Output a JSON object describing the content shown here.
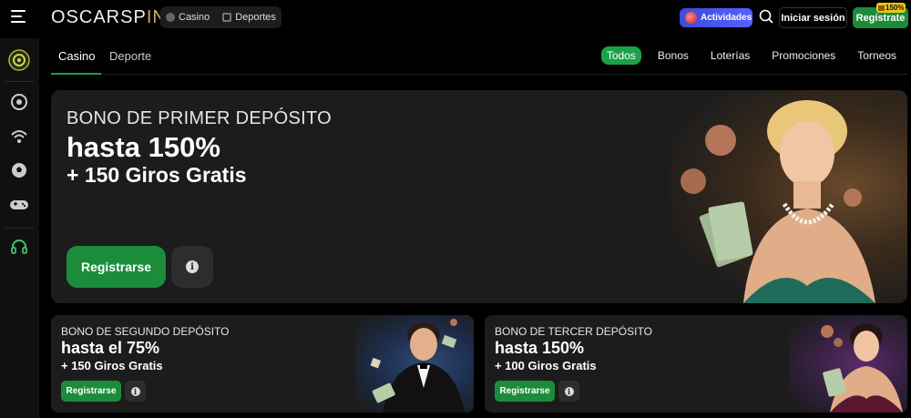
{
  "header": {
    "logo_main": "OSCARSP",
    "logo_accent": "IN",
    "nav": [
      {
        "label": "Casino",
        "icon": "casino-chip-icon"
      },
      {
        "label": "Deportes",
        "icon": "sports-grid-icon"
      }
    ],
    "activities_label": "Actividades",
    "login_label": "Iniciar sesión",
    "register_label": "Regístrate",
    "register_badge": "150%"
  },
  "sidebar": {
    "icons": [
      "oscar-logo-icon",
      "casino-chip-icon",
      "live-signal-icon",
      "soccer-ball-icon",
      "gamepad-icon",
      "support-headset-icon"
    ]
  },
  "tabs": [
    {
      "label": "Casino",
      "active": true
    },
    {
      "label": "Deporte",
      "active": false
    }
  ],
  "filters": [
    {
      "label": "Todos",
      "active": true
    },
    {
      "label": "Bonos",
      "active": false
    },
    {
      "label": "Loterías",
      "active": false
    },
    {
      "label": "Promociones",
      "active": false
    },
    {
      "label": "Torneos",
      "active": false
    }
  ],
  "hero": {
    "line1": "BONO DE PRIMER DEPÓSITO",
    "line2": "hasta 150%",
    "line3": "+ 150 Giros Gratis",
    "button_label": "Registrarse",
    "info_icon": "info-icon"
  },
  "cards": [
    {
      "line1": "BONO DE SEGUNDO DEPÓSITO",
      "line2": "hasta el 75%",
      "line3": "+ 150 Giros Gratis",
      "button_label": "Registrarse"
    },
    {
      "line1": "BONO DE TERCER DEPÓSITO",
      "line2": "hasta 150%",
      "line3": "+ 100 Giros Gratis",
      "button_label": "Registrarse"
    }
  ],
  "colors": {
    "accent_green": "#1b8d3a",
    "filter_active": "#1ba14a",
    "activities_blue": "#4350e6",
    "badge_gold": "#f0c419"
  },
  "info_glyph": "i"
}
